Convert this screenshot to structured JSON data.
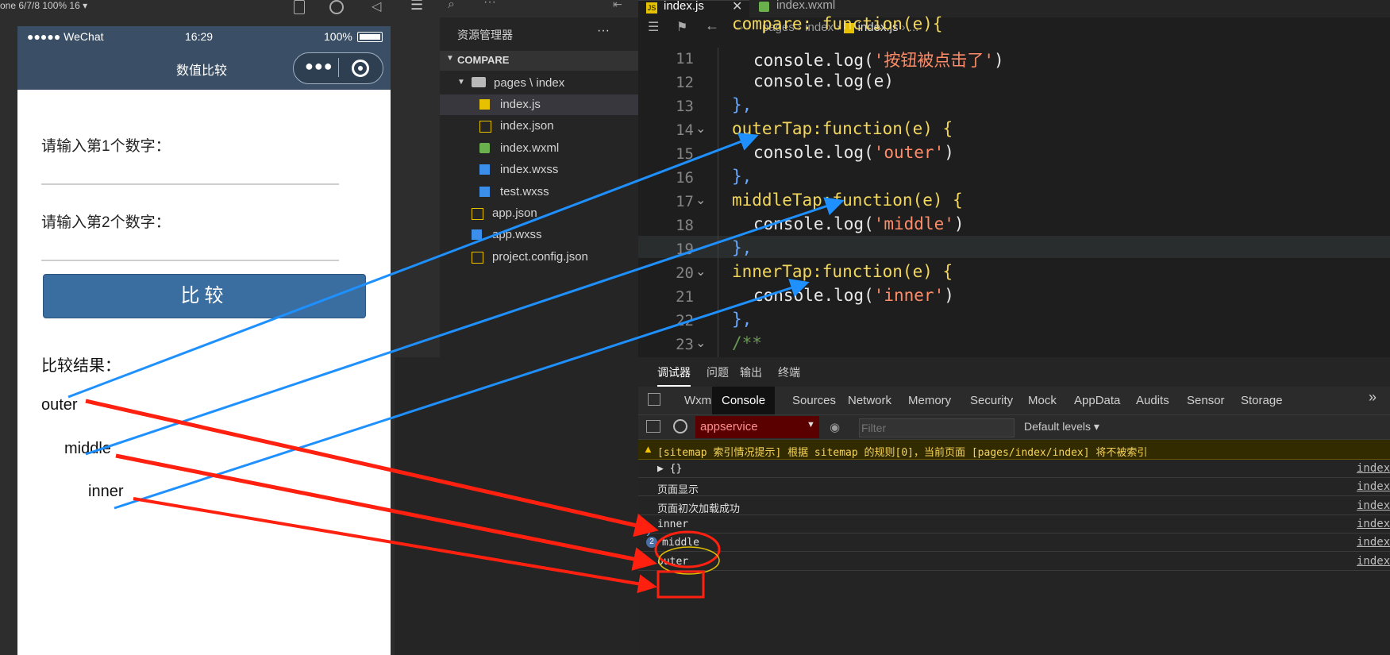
{
  "simulator": {
    "toolbar_text": "one 6/7/8 100% 16 ▾",
    "status": {
      "signal": "●●●●● WeChat",
      "time": "16:29",
      "battery": "100%"
    },
    "page_title": "数值比较",
    "label_1": "请输入第1个数字：",
    "label_2": "请输入第2个数字：",
    "compare_button": "比较",
    "result_label": "比较结果：",
    "outer": "outer",
    "middle": "middle",
    "inner": "inner"
  },
  "explorer": {
    "title": "资源管理器",
    "more": "···",
    "project": "COMPARE",
    "folder": "pages \\ index",
    "files": [
      {
        "name": "index.js",
        "icon": "js-file-icon"
      },
      {
        "name": "index.json",
        "icon": "json-file-icon"
      },
      {
        "name": "index.wxml",
        "icon": "wxml-file-icon"
      },
      {
        "name": "index.wxss",
        "icon": "wxss-file-icon"
      },
      {
        "name": "test.wxss",
        "icon": "wxss-file-icon"
      }
    ],
    "root_files": [
      {
        "name": "app.json",
        "icon": "json-file-icon"
      },
      {
        "name": "app.wxss",
        "icon": "wxss-file-icon"
      },
      {
        "name": "project.config.json",
        "icon": "json-file-icon"
      }
    ]
  },
  "editor": {
    "tabs": [
      "index.js",
      "index.wxml"
    ],
    "breadcrumb": [
      "pages",
      "index",
      "index.js",
      "..."
    ],
    "lines": [
      {
        "n": "",
        "text": "compare: function(e){"
      },
      {
        "n": "11",
        "text": "console.log('按钮被点击了')"
      },
      {
        "n": "12",
        "text": "console.log(e)"
      },
      {
        "n": "13",
        "text": "},"
      },
      {
        "n": "14",
        "text": "outerTap:function(e) {"
      },
      {
        "n": "15",
        "text": "console.log('outer')"
      },
      {
        "n": "16",
        "text": "},"
      },
      {
        "n": "17",
        "text": "middleTap:function(e) {"
      },
      {
        "n": "18",
        "text": "console.log('middle')"
      },
      {
        "n": "19",
        "text": "},"
      },
      {
        "n": "20",
        "text": "innerTap:function(e) {"
      },
      {
        "n": "21",
        "text": "console.log('inner')"
      },
      {
        "n": "22",
        "text": "},"
      },
      {
        "n": "23",
        "text": "/**"
      }
    ]
  },
  "devtools": {
    "top_tabs": [
      "调试器",
      "问题",
      "输出",
      "终端"
    ],
    "panel_tabs": [
      "Wxml",
      "Console",
      "Sources",
      "Network",
      "Memory",
      "Security",
      "Mock",
      "AppData",
      "Audits",
      "Sensor",
      "Storage"
    ],
    "active_panel": "Console",
    "context": "appservice",
    "filter_placeholder": "Filter",
    "levels": "Default levels ▾",
    "warning": "[sitemap 索引情况提示] 根据 sitemap 的规则[0]，当前页面 [pages/index/index] 将不被索引",
    "logs": [
      {
        "text": "▶ {}",
        "src": "index"
      },
      {
        "text": "页面显示",
        "src": "index"
      },
      {
        "text": "页面初次加载成功",
        "src": "index"
      },
      {
        "text": "inner",
        "src": "index"
      },
      {
        "text": "middle",
        "src": "index",
        "count": "2"
      },
      {
        "text": "outer",
        "src": "index"
      }
    ],
    "prompt": "›"
  },
  "colors": {
    "accent": "#1e90ff",
    "annotation": "#ff2010",
    "wx_header": "#3a4f66",
    "button": "#3a6da0"
  }
}
